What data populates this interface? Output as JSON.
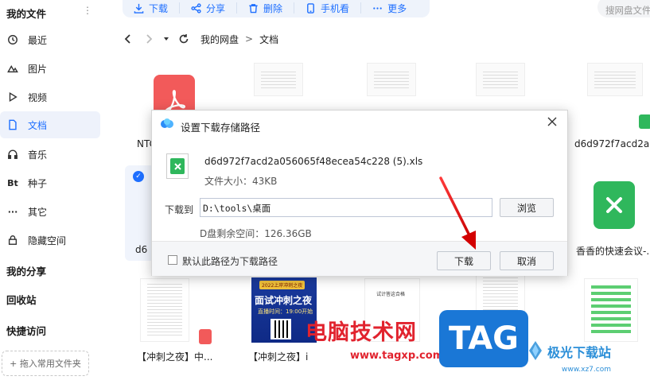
{
  "sidebar": {
    "my_files": "我的文件",
    "items": [
      {
        "label": "最近",
        "icon": "clock-icon"
      },
      {
        "label": "图片",
        "icon": "image-icon"
      },
      {
        "label": "视频",
        "icon": "play-icon"
      },
      {
        "label": "文档",
        "icon": "document-icon",
        "active": true
      },
      {
        "label": "音乐",
        "icon": "headphones-icon"
      },
      {
        "label": "种子",
        "icon": "bt-icon",
        "glyph": "Bt"
      },
      {
        "label": "其它",
        "icon": "more-icon",
        "glyph": "···"
      },
      {
        "label": "隐藏空间",
        "icon": "lock-icon"
      }
    ],
    "my_share": "我的分享",
    "recycle": "回收站",
    "quick_access": "快捷访问",
    "drop_zone": "+ 拖入常用文件夹"
  },
  "toolbar": {
    "download": "下载",
    "share": "分享",
    "delete": "删除",
    "phone_view": "手机看",
    "more": "更多",
    "search_placeholder": "搜网盘文件"
  },
  "nav": {
    "crumb_root": "我的网盘",
    "crumb_sep": ">",
    "crumb_current": "文档"
  },
  "files": {
    "row1_name1": "NTC",
    "row1_name5": "d6d972f7acd2a...",
    "row2_name1": "d6",
    "row2_name5": "香香的快速会议-...",
    "row3_name1": "【冲刺之夜】中...",
    "row3_name2": "【冲刺之夜】i",
    "poster_badge": "2022上岸冲刺之夜",
    "poster_title": "面试冲刺之夜",
    "poster_time": "直播时间：19:00开始",
    "doc_title": "试计答这合格"
  },
  "dialog": {
    "title": "设置下载存储路径",
    "file_name": "d6d972f7acd2a056065f48ecea54c228 (5).xls",
    "file_size": "文件大小：43KB",
    "download_to": "下载到",
    "path": "D:\\tools\\桌面",
    "browse": "浏览",
    "free_space": "D盘剩余空间：126.36GB",
    "default_path": "默认此路径为下载路径",
    "download_btn": "下载",
    "cancel_btn": "取消"
  },
  "watermark": {
    "site_name": "电脑技术网",
    "site_url": "www.tagxp.com",
    "tag": "TAG",
    "site2_name": "极光下载站",
    "site2_url": "www.xz7.com"
  },
  "colors": {
    "accent": "#1e6fff",
    "pdf_red": "#f25a5a",
    "excel_green": "#2fb75c",
    "watermark_red": "#e1232e",
    "tag_blue": "#1a77d6"
  }
}
